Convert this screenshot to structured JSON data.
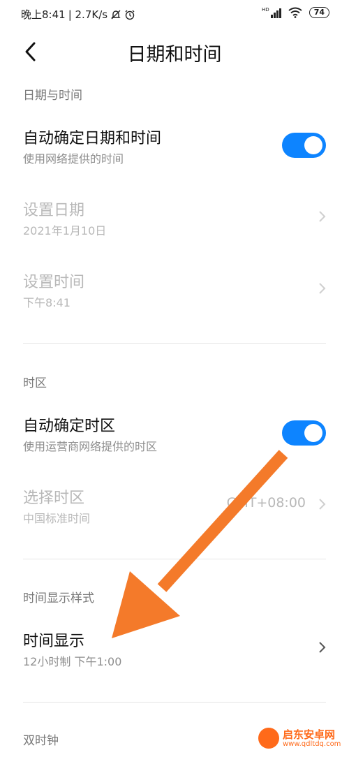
{
  "statusbar": {
    "time": "晚上8:41",
    "speed": "| 2.7K/s",
    "battery": "74",
    "hd": "HD"
  },
  "header": {
    "title": "日期和时间"
  },
  "sections": {
    "datetime": "日期与时间",
    "timezone": "时区",
    "display_style": "时间显示样式",
    "dual_clock": "双时钟"
  },
  "items": {
    "auto_datetime": {
      "title": "自动确定日期和时间",
      "subtitle": "使用网络提供的时间",
      "enabled": true
    },
    "set_date": {
      "title": "设置日期",
      "subtitle": "2021年1月10日"
    },
    "set_time": {
      "title": "设置时间",
      "subtitle": "下午8:41"
    },
    "auto_timezone": {
      "title": "自动确定时区",
      "subtitle": "使用运营商网络提供的时区",
      "enabled": true
    },
    "select_timezone": {
      "title": "选择时区",
      "subtitle": "中国标准时间",
      "value": "GMT+08:00"
    },
    "time_display": {
      "title": "时间显示",
      "subtitle": "12小时制 下午1:00"
    }
  },
  "watermark": {
    "name": "启东安卓网",
    "url": "www.qdltdq.com"
  },
  "colors": {
    "accent": "#0d84ff",
    "arrow": "#f47a2a"
  }
}
